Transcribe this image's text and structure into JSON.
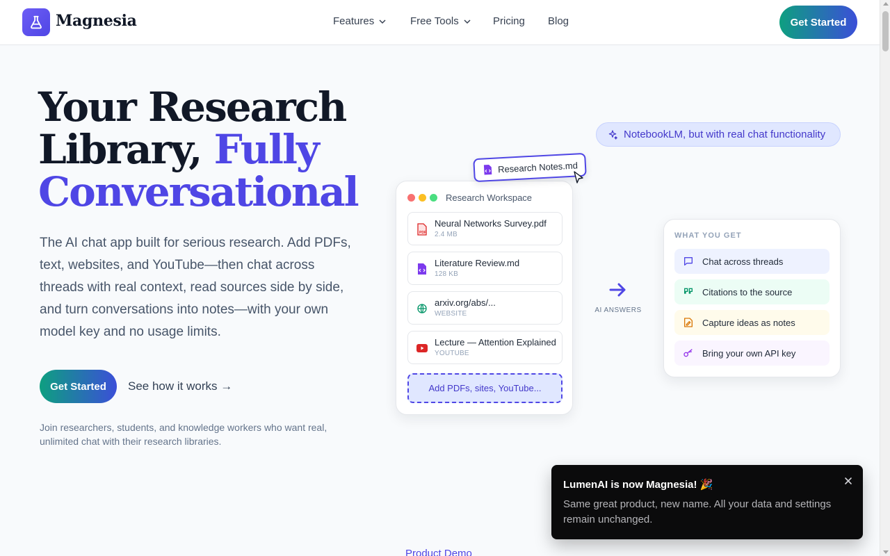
{
  "brand": {
    "name": "Magnesia"
  },
  "nav": {
    "items": [
      {
        "label": "Features",
        "has_dropdown": true
      },
      {
        "label": "Free Tools",
        "has_dropdown": true
      },
      {
        "label": "Pricing",
        "has_dropdown": false
      },
      {
        "label": "Blog",
        "has_dropdown": false
      }
    ],
    "cta": "Get Started"
  },
  "hero": {
    "title_line1": "Your Research",
    "title_line2_plain": "Library,",
    "title_line2_accent": "Fully",
    "title_line3_accent": "Conversational",
    "description": "The AI chat app built for serious research. Add PDFs, text, websites, and YouTube—then chat across threads with real context, read sources side by side, and turn conversations into notes—with your own model key and no usage limits.",
    "cta": "Get Started",
    "secondary_link": "See how it works →",
    "subtext": "Join researchers, students, and knowledge workers who want real, unlimited chat with their research libraries."
  },
  "visual": {
    "pill": "NotebookLM, but with real chat functionality",
    "drag_chip": "Research Notes.md",
    "workspace": {
      "title": "Research Workspace",
      "sources": [
        {
          "name": "Neural Networks Survey.pdf",
          "meta": "2.4 MB",
          "icon": "pdf-icon"
        },
        {
          "name": "Literature Review.md",
          "meta": "128 KB",
          "icon": "markdown-file-icon"
        },
        {
          "name": "arxiv.org/abs/...",
          "meta": "WEBSITE",
          "icon": "globe-icon"
        },
        {
          "name": "Lecture — Attention Explained",
          "meta": "YOUTUBE",
          "icon": "youtube-icon"
        }
      ],
      "add_label": "Add PDFs, sites, YouTube..."
    },
    "arrow_label": "AI ANSWERS",
    "benefits": {
      "heading": "WHAT YOU GET",
      "items": [
        {
          "label": "Chat across threads",
          "icon": "chat-bubble-icon",
          "color": "#eef2ff"
        },
        {
          "label": "Citations to the source",
          "icon": "quote-icon",
          "color": "#ecfdf5"
        },
        {
          "label": "Capture ideas as notes",
          "icon": "note-edit-icon",
          "color": "#fffbeb"
        },
        {
          "label": "Bring your own API key",
          "icon": "key-icon",
          "color": "#faf5ff"
        }
      ]
    }
  },
  "toast": {
    "title": "LumenAI is now Magnesia! 🎉",
    "body": "Same great product, new name. All your data and settings remain unchanged."
  },
  "next_section": {
    "label": "Product Demo"
  },
  "colors": {
    "accent": "#4f46e5",
    "gradient_start": "#0e9f80",
    "gradient_end": "#3b4fd8",
    "dot_red": "#f87171",
    "dot_yellow": "#fbbf24",
    "dot_green": "#4ade80"
  }
}
